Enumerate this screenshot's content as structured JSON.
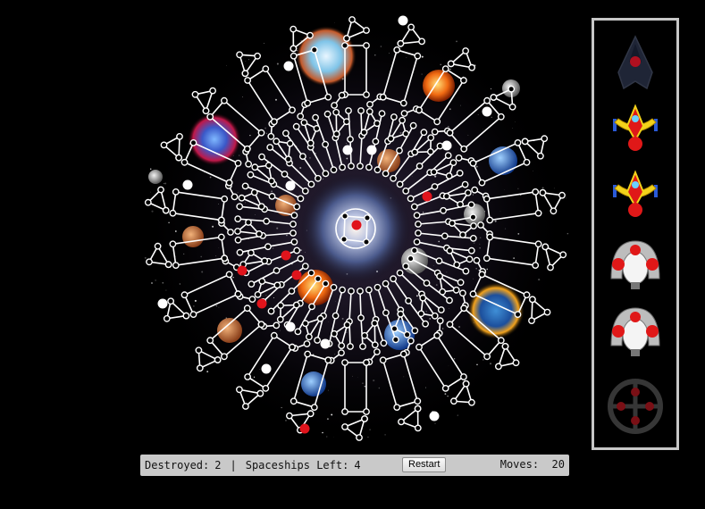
{
  "status_bar": {
    "destroyed_label": "Destroyed:",
    "destroyed_value": "2",
    "separator": "|",
    "spaceships_left_label": "Spaceships Left:",
    "spaceships_left_value": "4",
    "restart_label": "Restart",
    "moves_label": "Moves:",
    "moves_value": "20"
  },
  "ships": [
    {
      "name": "ship-slot-1",
      "kind": "fighter",
      "state": "destroyed"
    },
    {
      "name": "ship-slot-2",
      "kind": "fighter",
      "state": "active"
    },
    {
      "name": "ship-slot-3",
      "kind": "fighter",
      "state": "active"
    },
    {
      "name": "ship-slot-4",
      "kind": "cruiser",
      "state": "active"
    },
    {
      "name": "ship-slot-5",
      "kind": "cruiser",
      "state": "active"
    },
    {
      "name": "ship-slot-6",
      "kind": "wheel",
      "state": "destroyed"
    }
  ],
  "colors": {
    "background": "#000000",
    "board_lines": "#ffffff",
    "enemy_marker": "#e0141c",
    "player_marker": "#ffffff",
    "panel_border": "#c7c7c7",
    "status_bar": "#c9c9c9"
  }
}
